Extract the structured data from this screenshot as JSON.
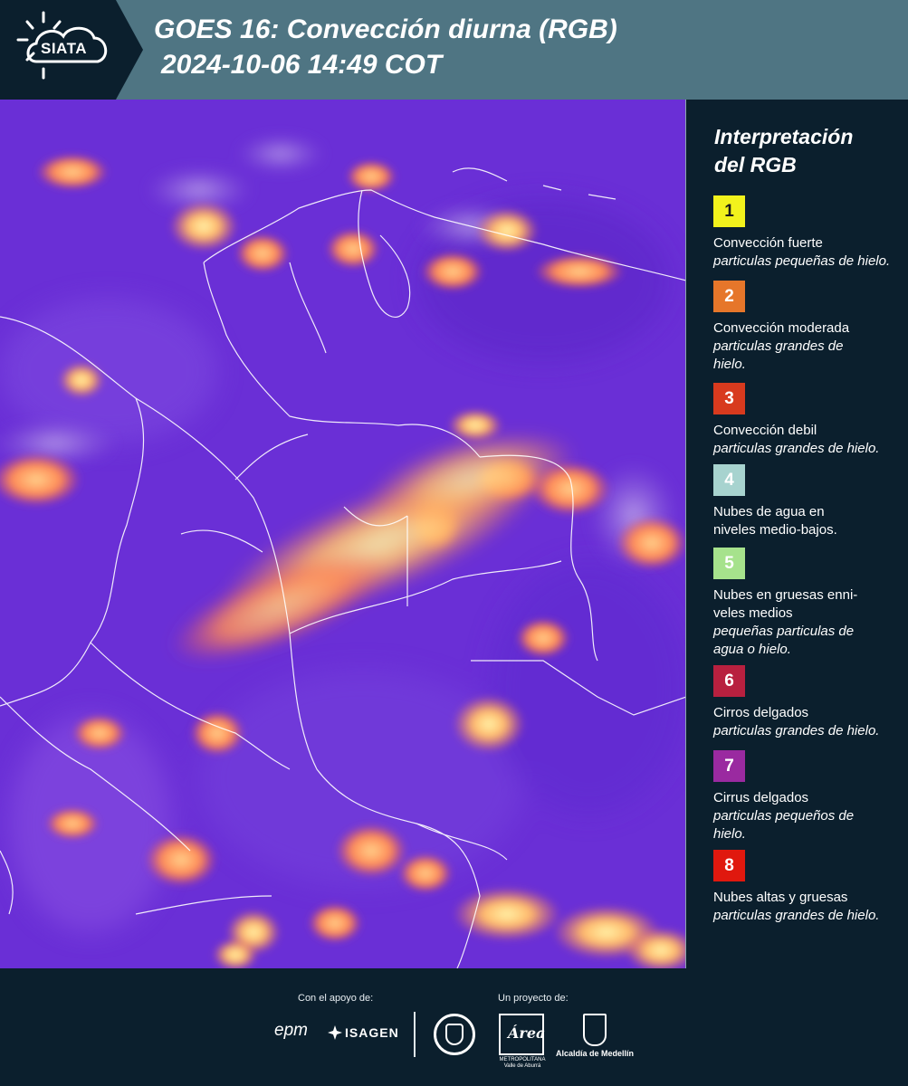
{
  "header": {
    "logo_text": "SIATA",
    "title": "GOES 16: Convección diurna (RGB)",
    "subtitle": "2024-10-06 14:49 COT",
    "background_color": "#4f7583"
  },
  "map": {
    "description_icon": "satellite-rgb-map",
    "background_color": "#6a2fd6"
  },
  "legend": {
    "title_line1": "Interpretación",
    "title_line2": "del RGB",
    "items": [
      {
        "number": "1",
        "color": "#f2f21c",
        "text_color": "#1a1a1a",
        "label": "Convección fuerte",
        "sub": "particulas pequeñas de hielo."
      },
      {
        "number": "2",
        "color": "#e6762a",
        "text_color": "#ffffff",
        "label": "Convección moderada",
        "sub": "particulas grandes de hielo."
      },
      {
        "number": "3",
        "color": "#d83a1e",
        "text_color": "#ffffff",
        "label": "Convección debil",
        "sub": "particulas grandes de hielo."
      },
      {
        "number": "4",
        "color": "#a7d3cf",
        "text_color": "#ffffff",
        "label": "Nubes de agua en niveles medio-bajos.",
        "sub": ""
      },
      {
        "number": "5",
        "color": "#a6e28c",
        "text_color": "#ffffff",
        "label": "Nubes en gruesas enni-veles medios",
        "sub": "pequeñas particulas de agua o hielo."
      },
      {
        "number": "6",
        "color": "#b8203f",
        "text_color": "#ffffff",
        "label": "Cirros delgados",
        "sub": "particulas grandes de hielo."
      },
      {
        "number": "7",
        "color": "#9a2aa0",
        "text_color": "#ffffff",
        "label": "Cirrus delgados",
        "sub": "particulas pequeños de hielo."
      },
      {
        "number": "8",
        "color": "#e0180e",
        "text_color": "#ffffff",
        "label": "Nubes altas y gruesas",
        "sub": "particulas grandes de hielo."
      }
    ]
  },
  "footer": {
    "support_label": "Con el apoyo de:",
    "project_label": "Un proyecto de:",
    "epm": "epm",
    "isagen": "ISAGEN",
    "area_logo_text": "Área",
    "area_caption": "METROPOLITANA Valle de Aburrá",
    "medellin_label": "Alcaldía de Medellín"
  }
}
